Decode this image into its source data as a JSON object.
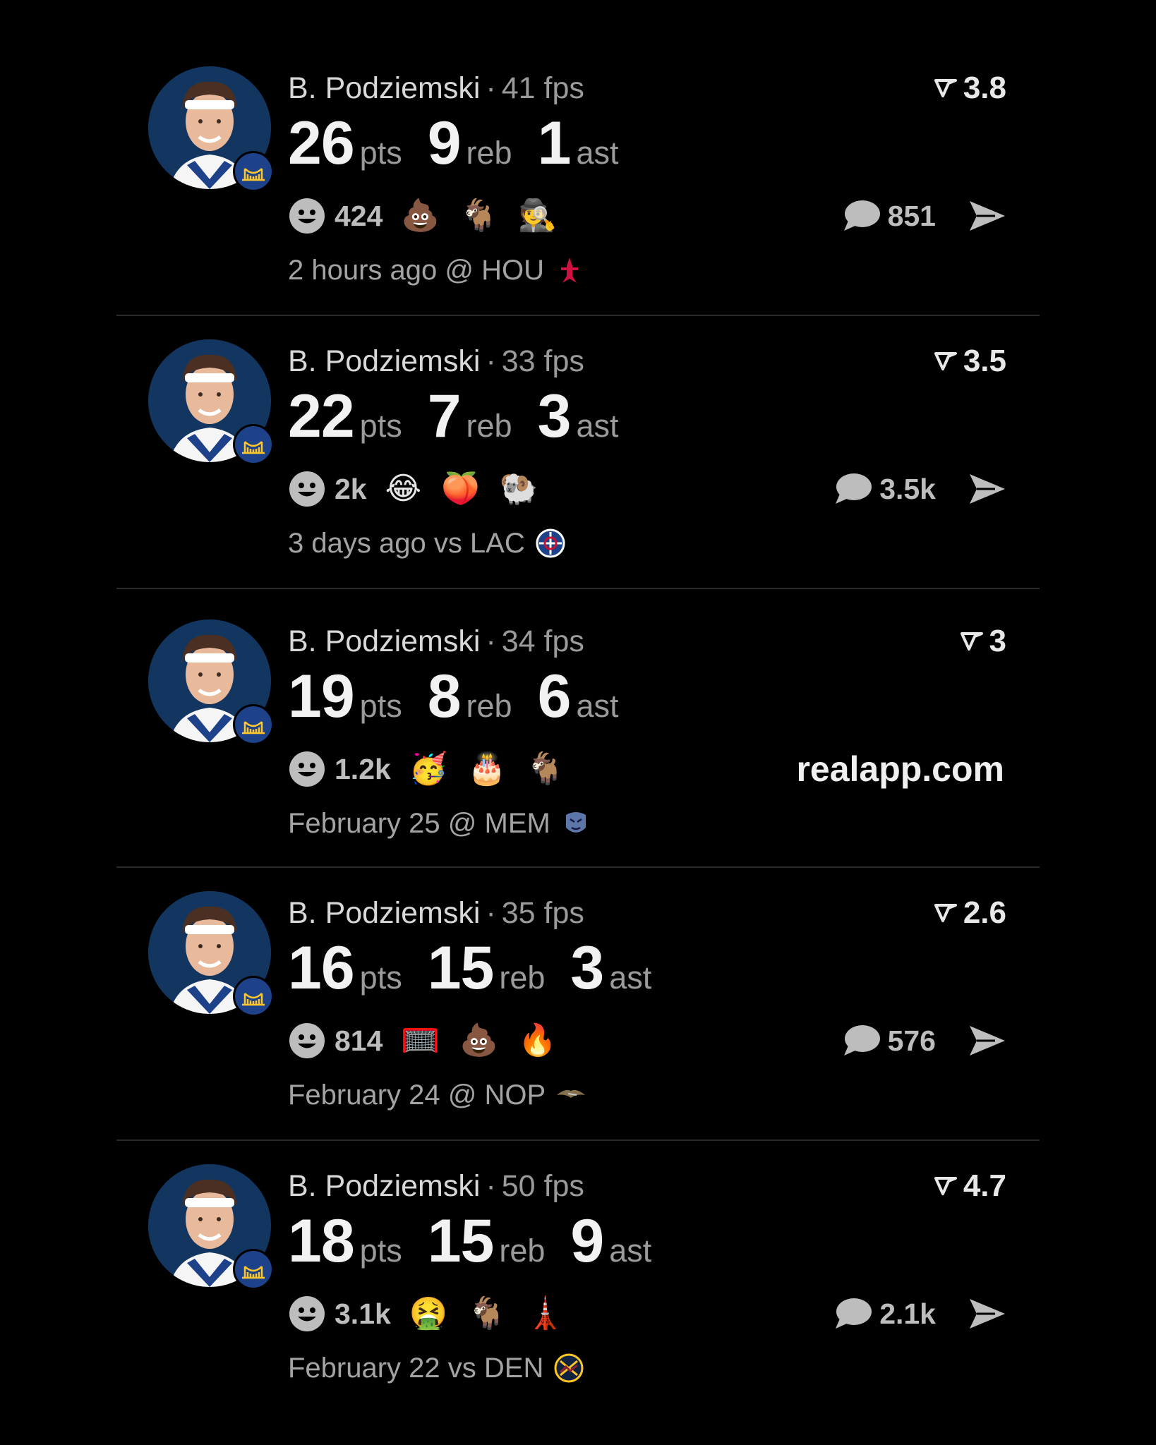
{
  "feed": {
    "posts": [
      {
        "player_name": "B. Podziemski",
        "separator": "·",
        "fps": "41 fps",
        "rating": "3.8",
        "pts": "26",
        "pts_label": "pts",
        "reb": "9",
        "reb_label": "reb",
        "ast": "1",
        "ast_label": "ast",
        "reaction_count": "424",
        "reactions": [
          "💩",
          "🐐",
          "🕵"
        ],
        "comment_count": "851",
        "meta": "2 hours ago @ HOU",
        "opponent_logo": "rockets-logo",
        "logo_color": "#ce1141"
      },
      {
        "player_name": "B. Podziemski",
        "separator": "·",
        "fps": "33 fps",
        "rating": "3.5",
        "pts": "22",
        "pts_label": "pts",
        "reb": "7",
        "reb_label": "reb",
        "ast": "3",
        "ast_label": "ast",
        "reaction_count": "2k",
        "reactions": [
          "😂",
          "🍑",
          "🐏"
        ],
        "comment_count": "3.5k",
        "meta": "3 days ago vs LAC",
        "opponent_logo": "clippers-logo",
        "logo_color": "#1d428a"
      },
      {
        "player_name": "B. Podziemski",
        "separator": "·",
        "fps": "34 fps",
        "rating": "3",
        "pts": "19",
        "pts_label": "pts",
        "reb": "8",
        "reb_label": "reb",
        "ast": "6",
        "ast_label": "ast",
        "reaction_count": "1.2k",
        "reactions": [
          "🥳",
          "🎂",
          "🐐"
        ],
        "watermark": "realapp.com",
        "meta": "February 25 @ MEM",
        "opponent_logo": "grizzlies-logo",
        "logo_color": "#5d76a9"
      },
      {
        "player_name": "B. Podziemski",
        "separator": "·",
        "fps": "35 fps",
        "rating": "2.6",
        "pts": "16",
        "pts_label": "pts",
        "reb": "15",
        "reb_label": "reb",
        "ast": "3",
        "ast_label": "ast",
        "reaction_count": "814",
        "reactions": [
          "🥅",
          "💩",
          "🔥"
        ],
        "comment_count": "576",
        "meta": "February 24 @ NOP",
        "opponent_logo": "pelicans-logo",
        "logo_color": "#85714d"
      },
      {
        "player_name": "B. Podziemski",
        "separator": "·",
        "fps": "50 fps",
        "rating": "4.7",
        "pts": "18",
        "pts_label": "pts",
        "reb": "15",
        "reb_label": "reb",
        "ast": "9",
        "ast_label": "ast",
        "reaction_count": "3.1k",
        "reactions": [
          "🤮",
          "🐐",
          "🗼"
        ],
        "comment_count": "2.1k",
        "meta": "February 22 vs DEN",
        "opponent_logo": "nuggets-logo",
        "logo_color": "#fec524"
      }
    ]
  },
  "colors": {
    "background": "#000000",
    "primary_text": "#f2f2f2",
    "secondary_text": "#9b9b9b",
    "team_blue": "#1d428a",
    "team_gold": "#ffc72c"
  },
  "icons": {
    "rating": "rating-icon",
    "reaction": "smiley-icon",
    "comment": "comment-icon",
    "send": "send-icon"
  }
}
